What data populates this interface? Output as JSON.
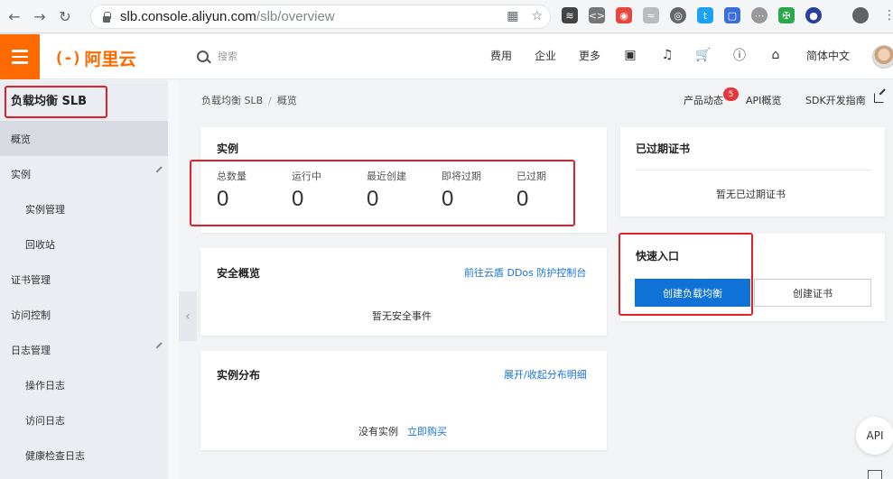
{
  "browser": {
    "url_host": "slb.console.aliyun.com",
    "url_path": "/slb/overview"
  },
  "topbar": {
    "brand": "阿里云",
    "search_placeholder": "搜索",
    "nav": [
      "费用",
      "企业",
      "更多"
    ],
    "language": "简体中文"
  },
  "sidebar": {
    "title": "负载均衡 SLB",
    "items": [
      {
        "label": "概览"
      },
      {
        "label": "实例"
      },
      {
        "label": "实例管理"
      },
      {
        "label": "回收站"
      },
      {
        "label": "证书管理"
      },
      {
        "label": "访问控制"
      },
      {
        "label": "日志管理"
      },
      {
        "label": "操作日志"
      },
      {
        "label": "访问日志"
      },
      {
        "label": "健康检查日志"
      }
    ]
  },
  "breadcrumb": {
    "root": "负载均衡 SLB",
    "sep": "/",
    "current": "概览"
  },
  "header_links": {
    "product_news": "产品动态",
    "product_news_badge": "5",
    "api_overview": "API概览",
    "sdk_guide": "SDK开发指南"
  },
  "instances_card": {
    "title": "实例",
    "stats": [
      {
        "label": "总数量",
        "value": "0"
      },
      {
        "label": "运行中",
        "value": "0"
      },
      {
        "label": "最近创建",
        "value": "0"
      },
      {
        "label": "即将过期",
        "value": "0"
      },
      {
        "label": "已过期",
        "value": "0"
      }
    ]
  },
  "security_card": {
    "title": "安全概览",
    "link": "前往云盾 DDos 防护控制台",
    "empty": "暂无安全事件"
  },
  "distribution_card": {
    "title": "实例分布",
    "link": "展开/收起分布明细",
    "empty": "没有实例",
    "buy_link": "立即购买"
  },
  "expired_cert_card": {
    "title": "已过期证书",
    "empty": "暂无已过期证书"
  },
  "quick_entry_card": {
    "title": "快速入口",
    "create_lb": "创建负载均衡",
    "create_cert": "创建证书"
  },
  "float": {
    "api": "API"
  },
  "colors": {
    "brand_orange": "#ff6a00",
    "primary_blue": "#0f72d6",
    "highlight_red": "#e0202c"
  }
}
